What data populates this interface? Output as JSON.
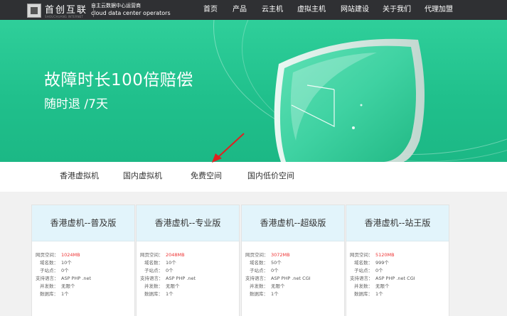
{
  "header": {
    "logo_text": "首创互联",
    "logo_en": "SHOUCHUANG INTERNET",
    "tagline_line1": "自主云数据中心运营商",
    "tagline_line2": "cloud data center operators",
    "nav": [
      {
        "label": "首页"
      },
      {
        "label": "产品"
      },
      {
        "label": "云主机"
      },
      {
        "label": "虚拟主机"
      },
      {
        "label": "网站建设"
      },
      {
        "label": "关于我们"
      },
      {
        "label": "代理加盟"
      }
    ]
  },
  "banner": {
    "title": "故障时长100倍赔偿",
    "subtitle": "随时退 /7天"
  },
  "tabs": [
    {
      "label": "香港虚拟机"
    },
    {
      "label": "国内虚拟机"
    },
    {
      "label": "免费空间"
    },
    {
      "label": "国内低价空间"
    }
  ],
  "cards": [
    {
      "title": "香港虚机--普及版",
      "specs": [
        {
          "label": "网页空间：",
          "value": "1024MB",
          "highlight": true
        },
        {
          "label": "域名数：",
          "value": "10个"
        },
        {
          "label": "子站点：",
          "value": "0个"
        },
        {
          "label": "支持语言：",
          "value": "ASP PHP .net"
        },
        {
          "label": "并发数：",
          "value": "无限个"
        },
        {
          "label": "数据库：",
          "value": "1个"
        }
      ]
    },
    {
      "title": "香港虚机--专业版",
      "specs": [
        {
          "label": "网页空间：",
          "value": "2048MB",
          "highlight": true
        },
        {
          "label": "域名数：",
          "value": "10个"
        },
        {
          "label": "子站点：",
          "value": "0个"
        },
        {
          "label": "支持语言：",
          "value": "ASP PHP .net"
        },
        {
          "label": "并发数：",
          "value": "无限个"
        },
        {
          "label": "数据库：",
          "value": "1个"
        }
      ]
    },
    {
      "title": "香港虚机--超级版",
      "specs": [
        {
          "label": "网页空间：",
          "value": "3072MB",
          "highlight": true
        },
        {
          "label": "域名数：",
          "value": "50个"
        },
        {
          "label": "子站点：",
          "value": "0个"
        },
        {
          "label": "支持语言：",
          "value": "ASP PHP .net CGI"
        },
        {
          "label": "并发数：",
          "value": "无限个"
        },
        {
          "label": "数据库：",
          "value": "1个"
        }
      ]
    },
    {
      "title": "香港虚机--站王版",
      "specs": [
        {
          "label": "网页空间：",
          "value": "5120MB",
          "highlight": true
        },
        {
          "label": "域名数：",
          "value": "999个"
        },
        {
          "label": "子站点：",
          "value": "0个"
        },
        {
          "label": "支持语言：",
          "value": "ASP PHP .net CGI"
        },
        {
          "label": "并发数：",
          "value": "无限个"
        },
        {
          "label": "数据库：",
          "value": "1个"
        }
      ]
    }
  ],
  "colors": {
    "header_bg": "#2f3033",
    "banner_green": "#20c08c",
    "highlight_red": "#e33",
    "card_head_bg": "#e2f4fb",
    "arrow_red": "#e02020"
  }
}
